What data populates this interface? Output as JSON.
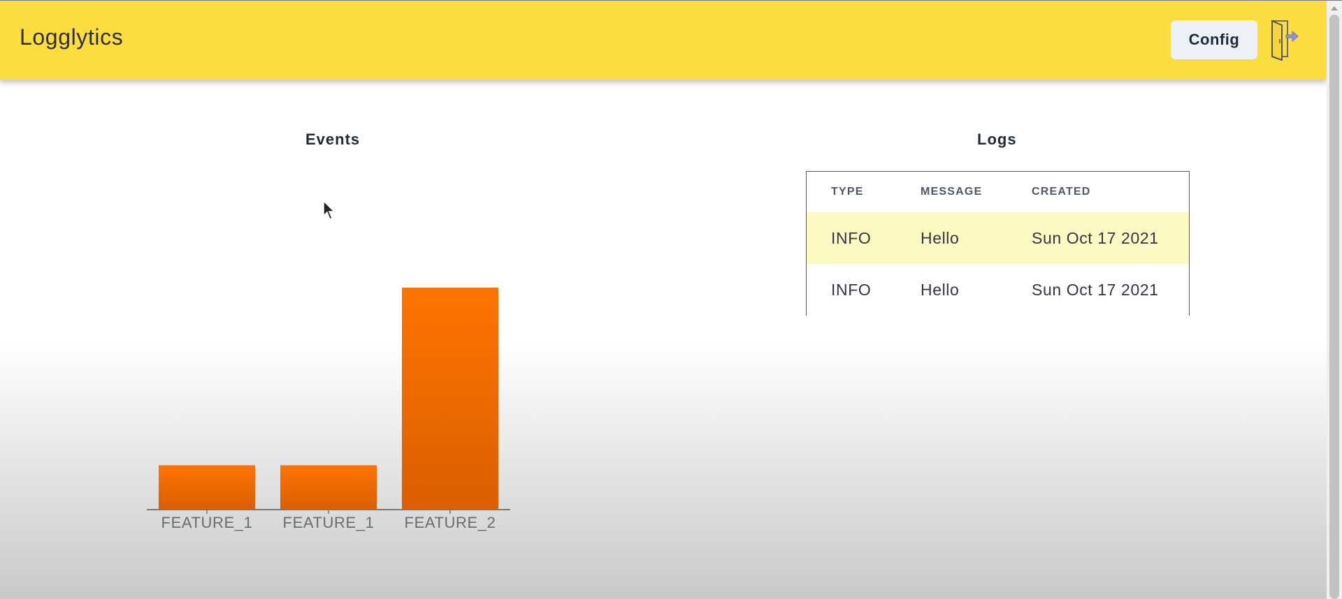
{
  "header": {
    "title": "Logglytics",
    "config_label": "Config",
    "logout_icon": "door-exit-icon",
    "background_color": "#fcdd40"
  },
  "events": {
    "title": "Events"
  },
  "logs": {
    "title": "Logs",
    "columns": [
      "TYPE",
      "MESSAGE",
      "CREATED"
    ],
    "rows": [
      {
        "type": "INFO",
        "message": "Hello",
        "created": "Sun Oct 17 2021"
      },
      {
        "type": "INFO",
        "message": "Hello",
        "created": "Sun Oct 17 2021"
      }
    ]
  },
  "chart_data": {
    "type": "bar",
    "categories": [
      "FEATURE_1",
      "FEATURE_1",
      "FEATURE_2"
    ],
    "values": [
      1,
      1,
      5
    ],
    "ylim": [
      0,
      5
    ],
    "bar_color": "#ff7400"
  }
}
